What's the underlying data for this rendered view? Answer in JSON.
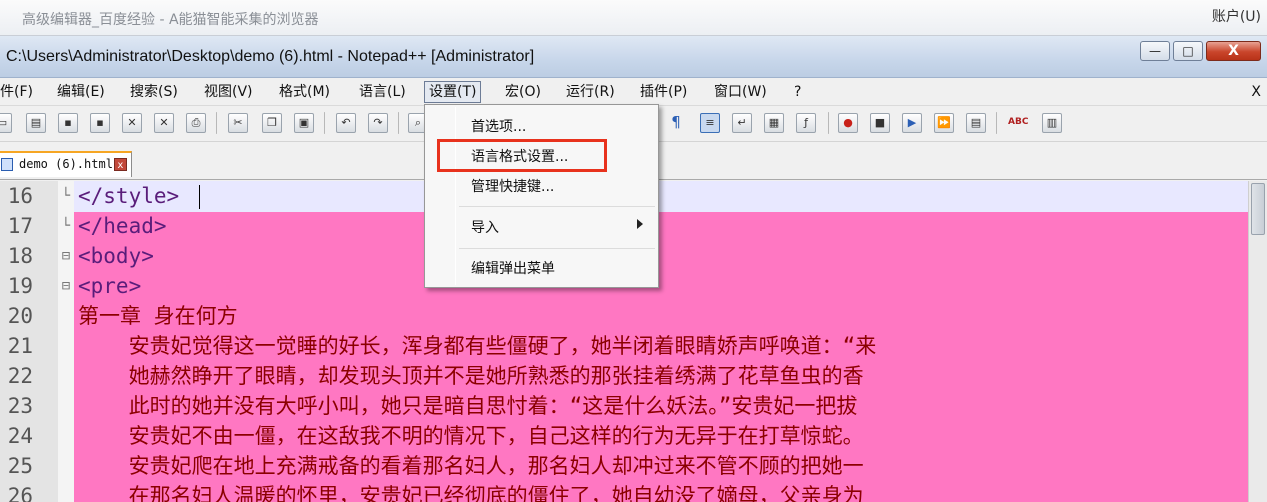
{
  "browser": {
    "title": "高级编辑器_百度经验 - A能猫智能采集的浏览器",
    "account_menu": "账户(U)"
  },
  "window": {
    "title": "C:\\Users\\Administrator\\Desktop\\demo (6).html - Notepad++ [Administrator]",
    "minimize": "—",
    "maximize": "□",
    "close": "X"
  },
  "menubar": {
    "items": [
      "件(F)",
      "编辑(E)",
      "搜索(S)",
      "视图(V)",
      "格式(M)",
      "语言(L)",
      "设置(T)",
      "宏(O)",
      "运行(R)",
      "插件(P)",
      "窗口(W)",
      "?"
    ],
    "active_index": 6,
    "close_label": "X"
  },
  "toolbar": {
    "icons": [
      "new-file-icon",
      "open-file-icon",
      "save-icon",
      "save-all-icon",
      "close-icon",
      "close-all-icon",
      "print-icon",
      "cut-icon",
      "copy-icon",
      "paste-icon",
      "undo-icon",
      "redo-icon",
      "find-icon",
      "pilcrow-icon",
      "indent-guide-icon",
      "wrap-icon",
      "folder-icon",
      "function-list-icon",
      "record-macro-icon",
      "stop-macro-icon",
      "play-macro-icon",
      "play-multiple-icon",
      "save-macro-icon",
      "spellcheck-icon",
      "run-icon"
    ],
    "spellcheck_label": "ABC"
  },
  "tab": {
    "label": "demo (6).html",
    "close": "x"
  },
  "dropdown": {
    "items": [
      {
        "label": "首选项..."
      },
      {
        "label": "语言格式设置..."
      },
      {
        "label": "管理快捷键..."
      },
      {
        "label": "导入"
      },
      {
        "label": "编辑弹出菜单"
      }
    ]
  },
  "editor": {
    "lines": [
      {
        "num": "16",
        "code": "</style>",
        "kind": "tag",
        "fold": "└"
      },
      {
        "num": "17",
        "code": "</head>",
        "kind": "tag",
        "fold": "└"
      },
      {
        "num": "18",
        "code": "<body>",
        "kind": "tag",
        "fold": "⊟"
      },
      {
        "num": "19",
        "code": "<pre>",
        "kind": "tag",
        "fold": "⊟"
      },
      {
        "num": "20",
        "code": "第一章 身在何方",
        "kind": "text",
        "fold": ""
      },
      {
        "num": "21",
        "code": "    安贵妃觉得这一觉睡的好长，浑身都有些僵硬了，她半闭着眼睛娇声呼唤道：“来",
        "kind": "text",
        "fold": ""
      },
      {
        "num": "22",
        "code": "    她赫然睁开了眼睛，却发现头顶并不是她所熟悉的那张挂着绣满了花草鱼虫的香",
        "kind": "text",
        "fold": ""
      },
      {
        "num": "23",
        "code": "    此时的她并没有大呼小叫，她只是暗自思忖着：“这是什么妖法。”安贵妃一把拔",
        "kind": "text",
        "fold": ""
      },
      {
        "num": "24",
        "code": "    安贵妃不由一僵，在这敌我不明的情况下，自己这样的行为无异于在打草惊蛇。",
        "kind": "text",
        "fold": ""
      },
      {
        "num": "25",
        "code": "    安贵妃爬在地上充满戒备的看着那名妇人，那名妇人却冲过来不管不顾的把她一",
        "kind": "text",
        "fold": ""
      },
      {
        "num": "26",
        "code": "    在那名妇人温暖的怀里，安贵妃已经彻底的僵住了，她自幼没了嫡母，父亲身为",
        "kind": "text",
        "fold": ""
      }
    ]
  }
}
